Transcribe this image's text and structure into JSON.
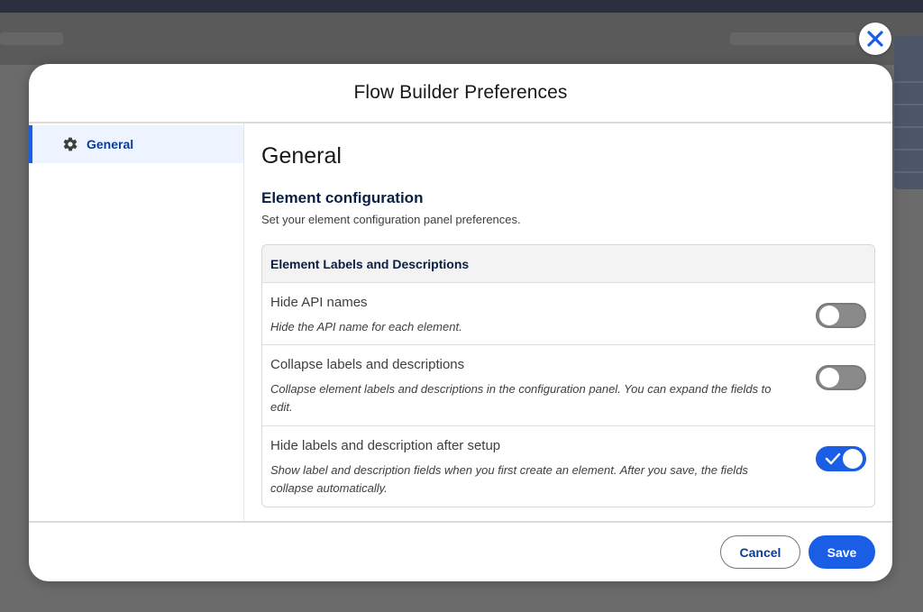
{
  "modal": {
    "title": "Flow Builder Preferences"
  },
  "sidebar": {
    "items": [
      {
        "label": "General",
        "icon": "gear-icon",
        "selected": true
      }
    ]
  },
  "content": {
    "title": "General",
    "section": {
      "title": "Element configuration",
      "description": "Set your element configuration panel preferences."
    },
    "card": {
      "header": "Element Labels and Descriptions",
      "rows": [
        {
          "label": "Hide API names",
          "description": "Hide the API name for each element.",
          "enabled": false
        },
        {
          "label": "Collapse labels and descriptions",
          "description": "Collapse element labels and descriptions in the configuration panel. You can expand the fields to edit.",
          "enabled": false
        },
        {
          "label": "Hide labels and description after setup",
          "description": "Show label and description fields when you first create an element. After you save, the fields collapse automatically.",
          "enabled": true
        }
      ]
    }
  },
  "footer": {
    "cancel_label": "Cancel",
    "save_label": "Save"
  },
  "colors": {
    "accent": "#1b5ee6",
    "sidebar_selected_bg": "#eef4ff",
    "toggle_off": "#8a8a8a",
    "overlay": "#6b6b6b"
  }
}
